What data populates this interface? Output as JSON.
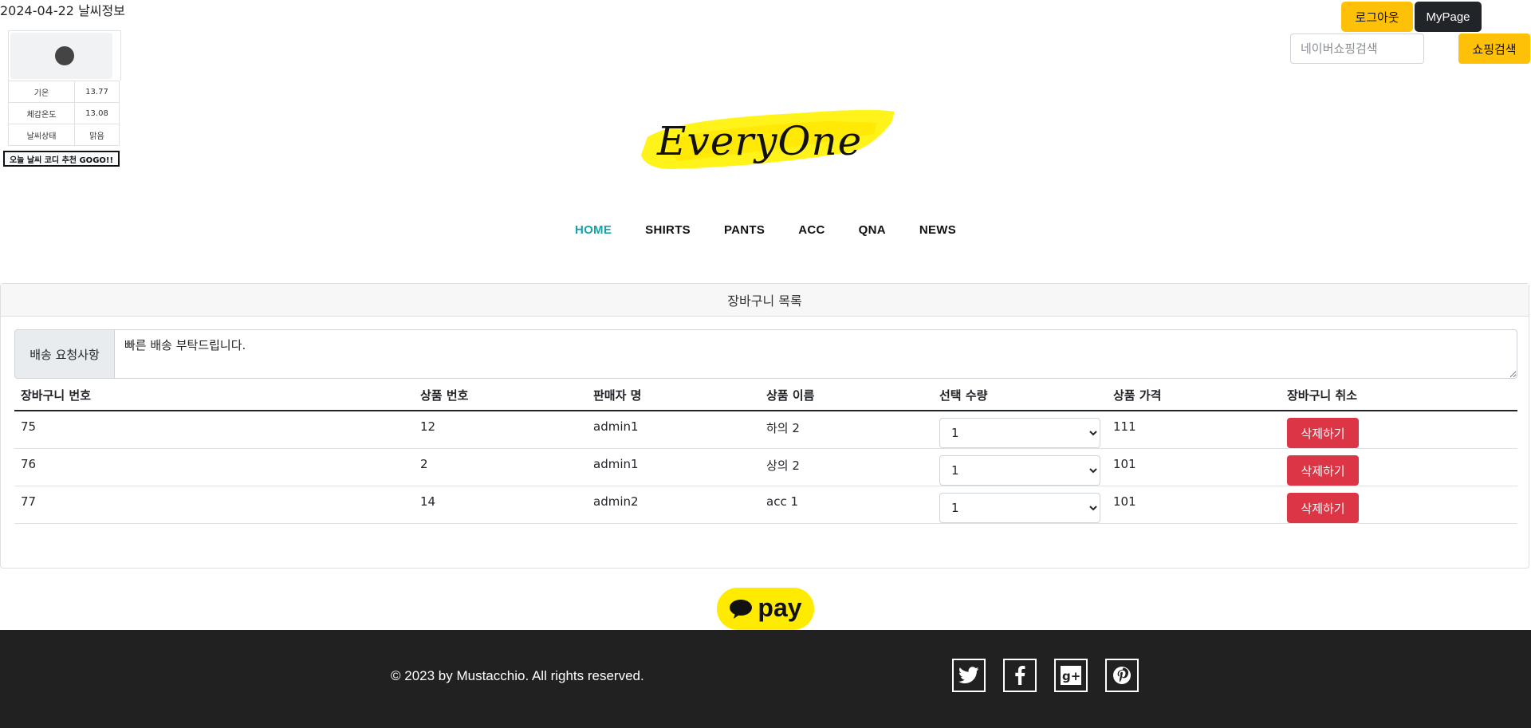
{
  "weather": {
    "title": "2024-04-22 날씨정보",
    "rows": [
      {
        "label": "기온",
        "value": "13.77"
      },
      {
        "label": "체감온도",
        "value": "13.08"
      },
      {
        "label": "날씨상태",
        "value": "맑음"
      }
    ],
    "coordi_button": "오늘 날씨 코디 추천 GOGO!!"
  },
  "header": {
    "logout": "로그아웃",
    "mypage": "MyPage",
    "search_placeholder": "네이버쇼핑검색",
    "search_button": "쇼핑검색",
    "logo_text": "EveryOne"
  },
  "nav": [
    "HOME",
    "SHIRTS",
    "PANTS",
    "ACC",
    "QNA",
    "NEWS"
  ],
  "cart": {
    "title": "장바구니 목록",
    "delivery_label": "배송 요청사항",
    "delivery_value": "빠른 배송 부탁드립니다.",
    "columns": [
      "장바구니 번호",
      "상품 번호",
      "판매자 명",
      "상품 이름",
      "선택 수량",
      "상품 가격",
      "장바구니 취소"
    ],
    "rows": [
      {
        "cart_no": "75",
        "product_no": "12",
        "seller": "admin1",
        "name": "하의 2",
        "qty": "1",
        "price": "111",
        "action": "삭제하기"
      },
      {
        "cart_no": "76",
        "product_no": "2",
        "seller": "admin1",
        "name": "상의 2",
        "qty": "1",
        "price": "101",
        "action": "삭제하기"
      },
      {
        "cart_no": "77",
        "product_no": "14",
        "seller": "admin2",
        "name": "acc 1",
        "qty": "1",
        "price": "101",
        "action": "삭제하기"
      }
    ]
  },
  "pay": {
    "label": "pay"
  },
  "footer": {
    "copyright": "© 2023 by Mustacchio. All rights reserved.",
    "social": [
      "twitter-icon",
      "facebook-icon",
      "google-plus-icon",
      "pinterest-icon"
    ]
  }
}
